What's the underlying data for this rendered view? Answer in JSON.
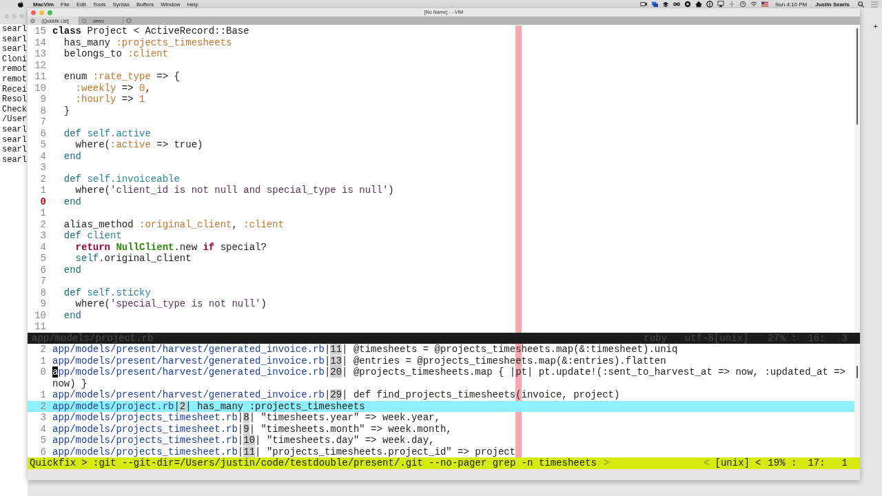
{
  "menu_bar": {
    "app_name": "MacVim",
    "menus": [
      "File",
      "Edit",
      "Tools",
      "Syntax",
      "Buffers",
      "Window",
      "Help"
    ],
    "clock": "Sun 4:10 PM",
    "user": "Justin Searls"
  },
  "terminal": {
    "lines": [
      "searl",
      "searl",
      "searl",
      "Cloni",
      "remot",
      "remot",
      "Recei",
      "Resol",
      "Check",
      "/User",
      "searl",
      "searl",
      "searl",
      "searl"
    ]
  },
  "window": {
    "title": "[No Name] - - VIM"
  },
  "tabs": [
    {
      "label": "-[Quickfix List]",
      "selected": true
    },
    {
      "label": ".vimrc",
      "selected": false
    }
  ],
  "new_tab": "+",
  "code_lines": [
    {
      "number": "15",
      "current": false,
      "tokens": [
        {
          "kind": "class",
          "text": "class"
        },
        {
          "kind": "plain",
          "text": " Project < ActiveRecord::Base"
        }
      ]
    },
    {
      "number": "14",
      "current": false,
      "tokens": [
        {
          "kind": "plain",
          "text": "  has_many "
        },
        {
          "kind": "symbol",
          "text": ":projects_timesheets"
        }
      ]
    },
    {
      "number": "13",
      "current": false,
      "tokens": [
        {
          "kind": "plain",
          "text": "  belongs_to "
        },
        {
          "kind": "symbol",
          "text": ":client"
        }
      ]
    },
    {
      "number": "12",
      "current": false
    },
    {
      "number": "11",
      "current": false,
      "tokens": [
        {
          "kind": "plain",
          "text": "  enum "
        },
        {
          "kind": "symbol",
          "text": ":rate_type"
        },
        {
          "kind": "plain",
          "text": " => {"
        }
      ]
    },
    {
      "number": "10",
      "current": false,
      "tokens": [
        {
          "kind": "symbol",
          "text": "    :weekly"
        },
        {
          "kind": "plain",
          "text": " => "
        },
        {
          "kind": "number",
          "text": "0"
        },
        {
          "kind": "plain",
          "text": ","
        }
      ]
    },
    {
      "number": "9",
      "current": false,
      "tokens": [
        {
          "kind": "symbol",
          "text": "    :hourly"
        },
        {
          "kind": "plain",
          "text": " => "
        },
        {
          "kind": "number",
          "text": "1"
        }
      ]
    },
    {
      "number": "8",
      "current": false,
      "tokens": [
        {
          "kind": "plain",
          "text": "  }"
        }
      ]
    },
    {
      "number": "7",
      "current": false
    },
    {
      "number": "6",
      "current": false,
      "tokens": [
        {
          "kind": "keyword",
          "text": "  def"
        },
        {
          "kind": "method",
          "text": " self.active"
        }
      ]
    },
    {
      "number": "5",
      "current": false,
      "tokens": [
        {
          "kind": "plain",
          "text": "    where("
        },
        {
          "kind": "symbol",
          "text": ":active"
        },
        {
          "kind": "plain",
          "text": " => true)"
        }
      ]
    },
    {
      "number": "4",
      "current": false,
      "tokens": [
        {
          "kind": "keyword",
          "text": "  end"
        }
      ]
    },
    {
      "number": "3",
      "current": false
    },
    {
      "number": "2",
      "current": false,
      "tokens": [
        {
          "kind": "keyword",
          "text": "  def"
        },
        {
          "kind": "method",
          "text": " self.invoiceable"
        }
      ]
    },
    {
      "number": "1",
      "current": false,
      "tokens": [
        {
          "kind": "plain",
          "text": "    where("
        },
        {
          "kind": "string",
          "text": "'client_id is not null and special_type is null'"
        },
        {
          "kind": "plain",
          "text": ")"
        }
      ]
    },
    {
      "number": "0",
      "current": true,
      "tokens": [
        {
          "kind": "keyword",
          "text": "  end"
        }
      ]
    },
    {
      "number": "1",
      "current": false
    },
    {
      "number": "2",
      "current": false,
      "tokens": [
        {
          "kind": "plain",
          "text": "  alias_method "
        },
        {
          "kind": "symbol",
          "text": ":original_client"
        },
        {
          "kind": "plain",
          "text": ", "
        },
        {
          "kind": "symbol",
          "text": ":client"
        }
      ]
    },
    {
      "number": "3",
      "current": false,
      "tokens": [
        {
          "kind": "keyword",
          "text": "  def"
        },
        {
          "kind": "method",
          "text": " client"
        }
      ]
    },
    {
      "number": "4",
      "current": false,
      "tokens": [
        {
          "kind": "control",
          "text": "    return"
        },
        {
          "kind": "constant",
          "text": " NullClient"
        },
        {
          "kind": "plain",
          "text": ".new "
        },
        {
          "kind": "control",
          "text": "if"
        },
        {
          "kind": "plain",
          "text": " special?"
        }
      ]
    },
    {
      "number": "5",
      "current": false,
      "tokens": [
        {
          "kind": "keyword",
          "text": "    self"
        },
        {
          "kind": "plain",
          "text": ".original_client"
        }
      ]
    },
    {
      "number": "6",
      "current": false,
      "tokens": [
        {
          "kind": "keyword",
          "text": "  end"
        }
      ]
    },
    {
      "number": "7",
      "current": false
    },
    {
      "number": "8",
      "current": false,
      "tokens": [
        {
          "kind": "keyword",
          "text": "  def"
        },
        {
          "kind": "method",
          "text": " self.sticky"
        }
      ]
    },
    {
      "number": "9",
      "current": false,
      "tokens": [
        {
          "kind": "plain",
          "text": "    where("
        },
        {
          "kind": "string",
          "text": "'special_type is not null'"
        },
        {
          "kind": "plain",
          "text": ")"
        }
      ]
    },
    {
      "number": "10",
      "current": false,
      "tokens": [
        {
          "kind": "keyword",
          "text": "  end"
        }
      ]
    },
    {
      "number": "11",
      "current": false
    }
  ],
  "editor_status": {
    "file": "app/models/project.rb",
    "filetype": "ruby",
    "encoding": "utf-8[unix]",
    "percent": "27% :",
    "line": "16:",
    "column": "3"
  },
  "quickfix": [
    {
      "number": "2",
      "file": "app/models/present/harvest/generated_invoice.rb",
      "line_ref": "|11|",
      "text": "@timesheets = @projects_timesheets.map(&:timesheet).uniq",
      "selected": false,
      "cursor": false
    },
    {
      "number": "1",
      "file": "app/models/present/harvest/generated_invoice.rb",
      "line_ref": "|13|",
      "text": "@entries = @projects_timesheets.map(&:entries).flatten",
      "selected": false,
      "cursor": false
    },
    {
      "number": "0",
      "file": "app/models/present/harvest/generated_invoice.rb",
      "line_ref": "|20|",
      "text": "@projects_timesheets.map { |pt| pt.update!(:sent_to_harvest_at => now, :updated_at =>",
      "continuation": "now) }",
      "selected": false,
      "cursor": true
    },
    {
      "number": "1",
      "file": "app/models/present/harvest/generated_invoice.rb",
      "line_ref": "|29|",
      "text": "def find_projects_timesheets(invoice, project)",
      "selected": false,
      "cursor": false
    },
    {
      "number": "2",
      "file": "app/models/project.rb",
      "line_ref": "|2|",
      "text": "has_many :projects_timesheets",
      "selected": true,
      "cursor": false
    },
    {
      "number": "3",
      "file": "app/models/projects_timesheet.rb",
      "line_ref": "|8|",
      "text": "\"timesheets.year\" => week.year,",
      "selected": false,
      "cursor": false
    },
    {
      "number": "4",
      "file": "app/models/projects_timesheet.rb",
      "line_ref": "|9|",
      "text": "\"timesheets.month\" => week.month,",
      "selected": false,
      "cursor": false
    },
    {
      "number": "5",
      "file": "app/models/projects_timesheet.rb",
      "line_ref": "|10|",
      "text": "\"timesheets.day\" => week.day,",
      "selected": false,
      "cursor": false
    },
    {
      "number": "6",
      "file": "app/models/projects_timesheet.rb",
      "line_ref": "|11|",
      "text": "\"projects_timesheets.project_id\" => project",
      "selected": false,
      "cursor": false
    }
  ],
  "quickfix_status": {
    "mode": "Quickfix",
    "command": "> :git --git-dir=/Users/justin/code/testdouble/present/.git --no-pager grep -n timesheets",
    "separator": ">",
    "left_arrow": "<",
    "format": "[unix]",
    "arrow": "<",
    "percent": "19% :",
    "line": "17:",
    "column": "1"
  }
}
